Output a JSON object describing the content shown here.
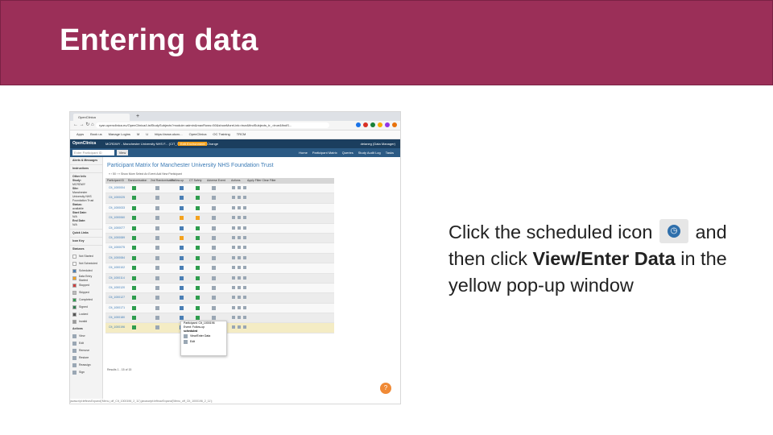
{
  "slide": {
    "title": "Entering data"
  },
  "instructions": {
    "part1": "Click the scheduled icon",
    "part2": "and",
    "part3": "then click",
    "bold": "View/Enter Data",
    "part4": "in the",
    "part5": "yellow pop-up window"
  },
  "browser": {
    "tab_title": "OpenClinica",
    "tab_plus": "+",
    "nav_glyphs": "← → ↻ ⌂",
    "url": "ryan.openclinica.eu/OpenClinica/ListStudySubjects?module=admin&maxRows=50&showMoreLink=true&findSubjects_tr_=true&findS...",
    "ext_colors": [
      "#1a73e8",
      "#d93025",
      "#188038",
      "#f9ab00",
      "#9334e6",
      "#e8710a"
    ],
    "bookmarks": [
      "Apps",
      "Book us",
      "Manage Logins",
      "M",
      "U",
      "https://www.ukcrc...",
      "OpenClinica",
      "OC Training",
      "TRCM"
    ]
  },
  "openclinica": {
    "logo": "OpenClinica",
    "study": "MCRDWY - Manchester University NHS F... (CIT_TRP)",
    "study_button": "Edit Environment",
    "change": "Change",
    "user": "deianeg (Data Manager)",
    "participant_placeholder": "Enter Participant ID",
    "view_button": "View",
    "menu": [
      "Home",
      "Participant Matrix",
      "Queries",
      "Study Audit Log",
      "Tasks"
    ]
  },
  "sidebar": {
    "alerts": "Alerts & Messages",
    "instructions": "Instructions",
    "other_info": "Other Info",
    "study_label": "Study:",
    "study_value": "MCRDWY",
    "site_label": "Site:",
    "site_value": "Manchester University NHS Foundation Trust",
    "status_label": "Status:",
    "status_value": "available",
    "start_label": "Start Date:",
    "start_value": "N/A",
    "end_label": "End Date:",
    "end_value": "N/A",
    "quick_links": "Quick Links",
    "icon_key": "Icon Key",
    "statuses_label": "Statuses",
    "statuses": [
      {
        "name": "Not Started",
        "color": "#ffffff"
      },
      {
        "name": "Not Scheduled",
        "color": "#ffffff"
      },
      {
        "name": "Scheduled",
        "color": "#4a7fb5"
      },
      {
        "name": "Data Entry Started",
        "color": "#f4a21d"
      },
      {
        "name": "Stopped",
        "color": "#d04040"
      },
      {
        "name": "Skipped",
        "color": "#bbbbbb"
      },
      {
        "name": "Completed",
        "color": "#2e9d4e"
      },
      {
        "name": "Signed",
        "color": "#2e7d4e"
      },
      {
        "name": "Locked",
        "color": "#555555"
      },
      {
        "name": "Invalid",
        "color": "#999999"
      }
    ],
    "actions_label": "Actions",
    "actions": [
      "View",
      "Edit",
      "Remove",
      "Restore",
      "Reassign",
      "Sign"
    ]
  },
  "matrix": {
    "title": "Participant Matrix for Manchester University NHS Foundation Trust",
    "controls": "« ‹  50  ›  »   Show More   Select An Event   Add New Participant",
    "headers": [
      "Participant ID",
      "Randomisation",
      "2nd Randomisation",
      "Follow-up",
      "CT Safety",
      "Adverse Event",
      "Actions"
    ],
    "apply_filter": "Apply Filter   Clear Filter",
    "rows": [
      {
        "id": "CIt_1000004",
        "c": [
          "#2e9d4e",
          "#9aa7b4",
          "#4a7fb5",
          "#2e9d4e",
          "#9aa7b4"
        ]
      },
      {
        "id": "CIt_1000025",
        "c": [
          "#2e9d4e",
          "#9aa7b4",
          "#4a7fb5",
          "#2e9d4e",
          "#9aa7b4"
        ]
      },
      {
        "id": "CIt_1000033",
        "c": [
          "#2e9d4e",
          "#9aa7b4",
          "#4a7fb5",
          "#2e9d4e",
          "#9aa7b4"
        ]
      },
      {
        "id": "CIt_1000060",
        "c": [
          "#2e9d4e",
          "#9aa7b4",
          "#f4a21d",
          "#f4a21d",
          "#9aa7b4"
        ]
      },
      {
        "id": "CIt_1000077",
        "c": [
          "#2e9d4e",
          "#9aa7b4",
          "#4a7fb5",
          "#2e9d4e",
          "#9aa7b4"
        ]
      },
      {
        "id": "CIt_1000089",
        "c": [
          "#2e9d4e",
          "#9aa7b4",
          "#f4a21d",
          "#2e9d4e",
          "#9aa7b4"
        ]
      },
      {
        "id": "CIt_1000075",
        "c": [
          "#2e9d4e",
          "#9aa7b4",
          "#4a7fb5",
          "#2e9d4e",
          "#9aa7b4"
        ]
      },
      {
        "id": "CIt_1000084",
        "c": [
          "#2e9d4e",
          "#9aa7b4",
          "#4a7fb5",
          "#2e9d4e",
          "#9aa7b4"
        ]
      },
      {
        "id": "CIt_1000102",
        "c": [
          "#2e9d4e",
          "#9aa7b4",
          "#4a7fb5",
          "#2e9d4e",
          "#9aa7b4"
        ]
      },
      {
        "id": "CIt_1000114",
        "c": [
          "#2e9d4e",
          "#9aa7b4",
          "#4a7fb5",
          "#2e9d4e",
          "#9aa7b4"
        ]
      },
      {
        "id": "CIt_1000120",
        "c": [
          "#2e9d4e",
          "#9aa7b4",
          "#4a7fb5",
          "#2e9d4e",
          "#9aa7b4"
        ]
      },
      {
        "id": "CIt_1000127",
        "c": [
          "#2e9d4e",
          "#9aa7b4",
          "#4a7fb5",
          "#2e9d4e",
          "#9aa7b4"
        ]
      },
      {
        "id": "CIt_1000171",
        "c": [
          "#2e9d4e",
          "#9aa7b4",
          "#4a7fb5",
          "#2e9d4e",
          "#9aa7b4"
        ]
      },
      {
        "id": "CIt_1000180",
        "c": [
          "#2e9d4e",
          "#9aa7b4",
          "#4a7fb5",
          "#2e9d4e",
          "#9aa7b4"
        ]
      },
      {
        "id": "CIt_1000196",
        "c": [
          "#2e9d4e",
          "#9aa7b4",
          "#4a7fb5",
          "#9aa7b4",
          "#9aa7b4"
        ],
        "highlight": true
      }
    ],
    "results": "Results 1 - 15 of 15"
  },
  "popup": {
    "participant": "Participant: CIt_1000196",
    "event": "Event: Follow-up",
    "status": "scheduled",
    "view_enter": "View/Enter Data",
    "edit": "Edit"
  },
  "status_bar": "javascript:leftnavExpand('Menu_off_CIt_1000196_2_11');javascript:leftnavExpand('Menu_off_CIt_1000196_2_11');",
  "help_glyph": "?"
}
